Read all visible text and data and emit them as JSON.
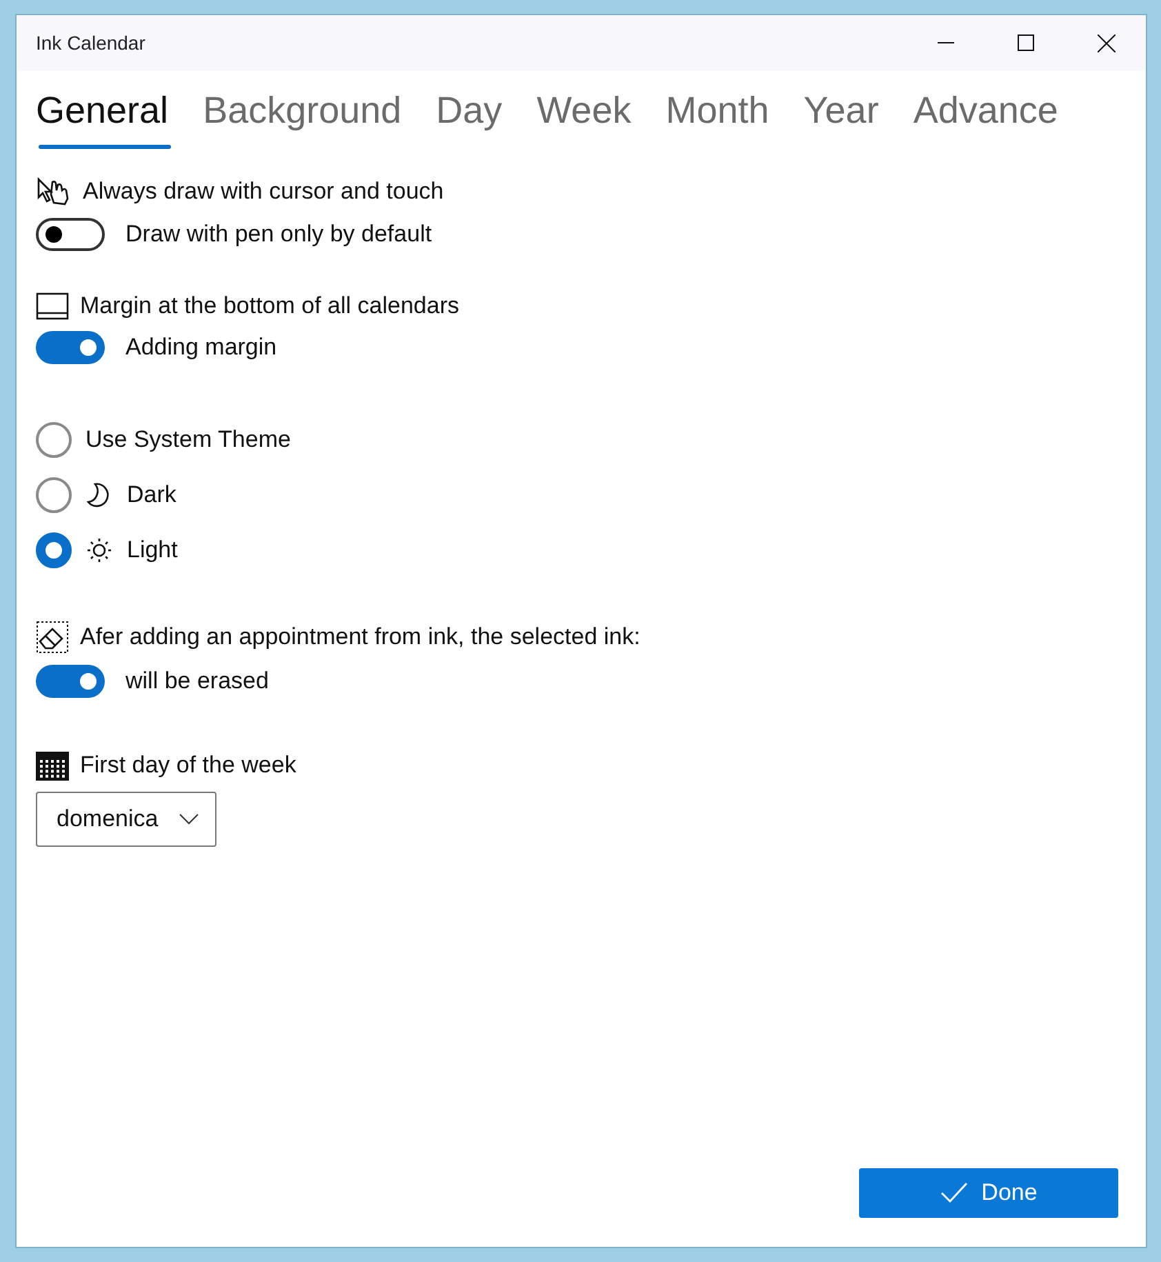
{
  "window": {
    "title": "Ink Calendar"
  },
  "tabs": [
    {
      "label": "General",
      "selected": true
    },
    {
      "label": "Background",
      "selected": false
    },
    {
      "label": "Day",
      "selected": false
    },
    {
      "label": "Week",
      "selected": false
    },
    {
      "label": "Month",
      "selected": false
    },
    {
      "label": "Year",
      "selected": false
    },
    {
      "label": "Advance",
      "selected": false
    }
  ],
  "sections": [
    {
      "kind": "toggle",
      "heading": "Always draw with cursor and touch",
      "label": "Draw with pen only by default",
      "on": false
    },
    {
      "kind": "toggle",
      "heading": "Margin at the bottom of all calendars",
      "label": "Adding margin",
      "on": true
    },
    {
      "kind": "radio",
      "options": [
        {
          "label": "Use System Theme",
          "selected": false
        },
        {
          "label": "Dark",
          "selected": false
        },
        {
          "label": "Light",
          "selected": true
        }
      ]
    },
    {
      "kind": "toggle",
      "heading": "Afer adding an appointment from ink, the selected ink:",
      "label": "will be erased",
      "on": true
    },
    {
      "kind": "dropdown",
      "heading": "First day of the week",
      "value": "domenica"
    }
  ],
  "done_button": {
    "label": "Done"
  }
}
